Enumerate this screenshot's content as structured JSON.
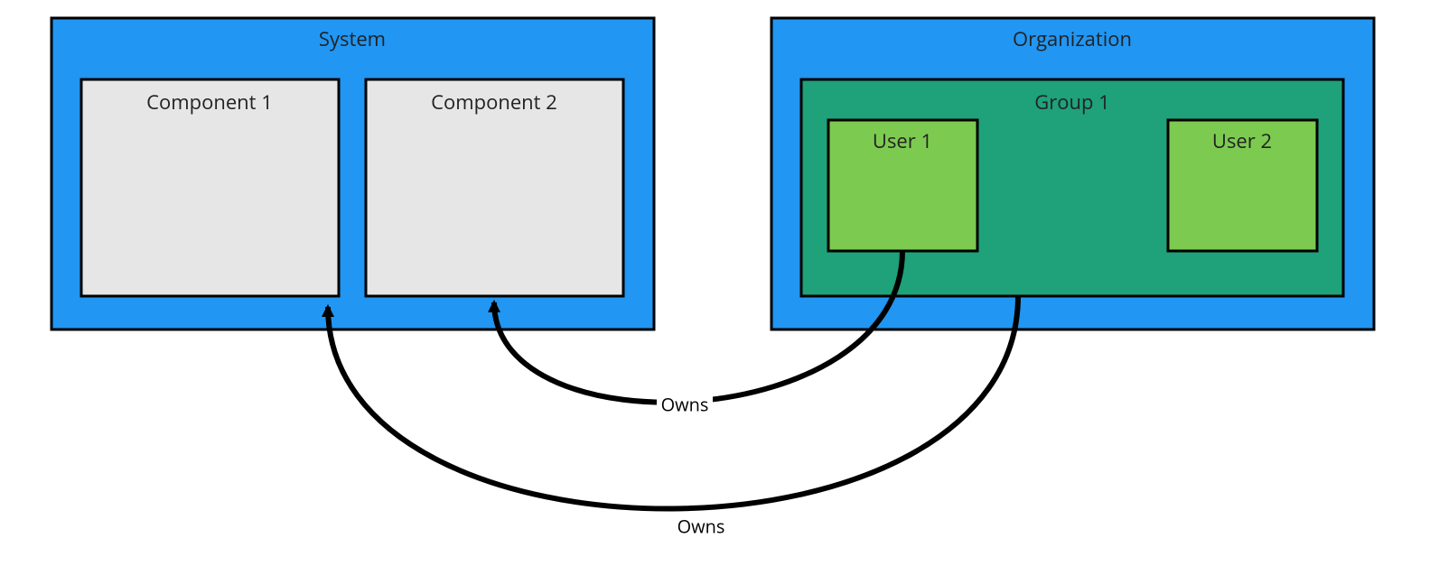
{
  "nodes": {
    "system": {
      "label": "System",
      "fill": "#2196f3",
      "stroke": "#000000"
    },
    "component1": {
      "label": "Component 1",
      "fill": "#e6e6e6",
      "stroke": "#000000"
    },
    "component2": {
      "label": "Component 2",
      "fill": "#e6e6e6",
      "stroke": "#000000"
    },
    "organization": {
      "label": "Organization",
      "fill": "#2196f3",
      "stroke": "#000000"
    },
    "group1": {
      "label": "Group 1",
      "fill": "#1fa17a",
      "stroke": "#000000"
    },
    "user1": {
      "label": "User 1",
      "fill": "#7ccb50",
      "stroke": "#000000"
    },
    "user2": {
      "label": "User 2",
      "fill": "#7ccb50",
      "stroke": "#000000"
    }
  },
  "edges": {
    "owns_user1_comp2": {
      "label": "Owns",
      "from": "user1",
      "to": "component2"
    },
    "owns_group1_comp1": {
      "label": "Owns",
      "from": "group1",
      "to": "component1"
    }
  }
}
